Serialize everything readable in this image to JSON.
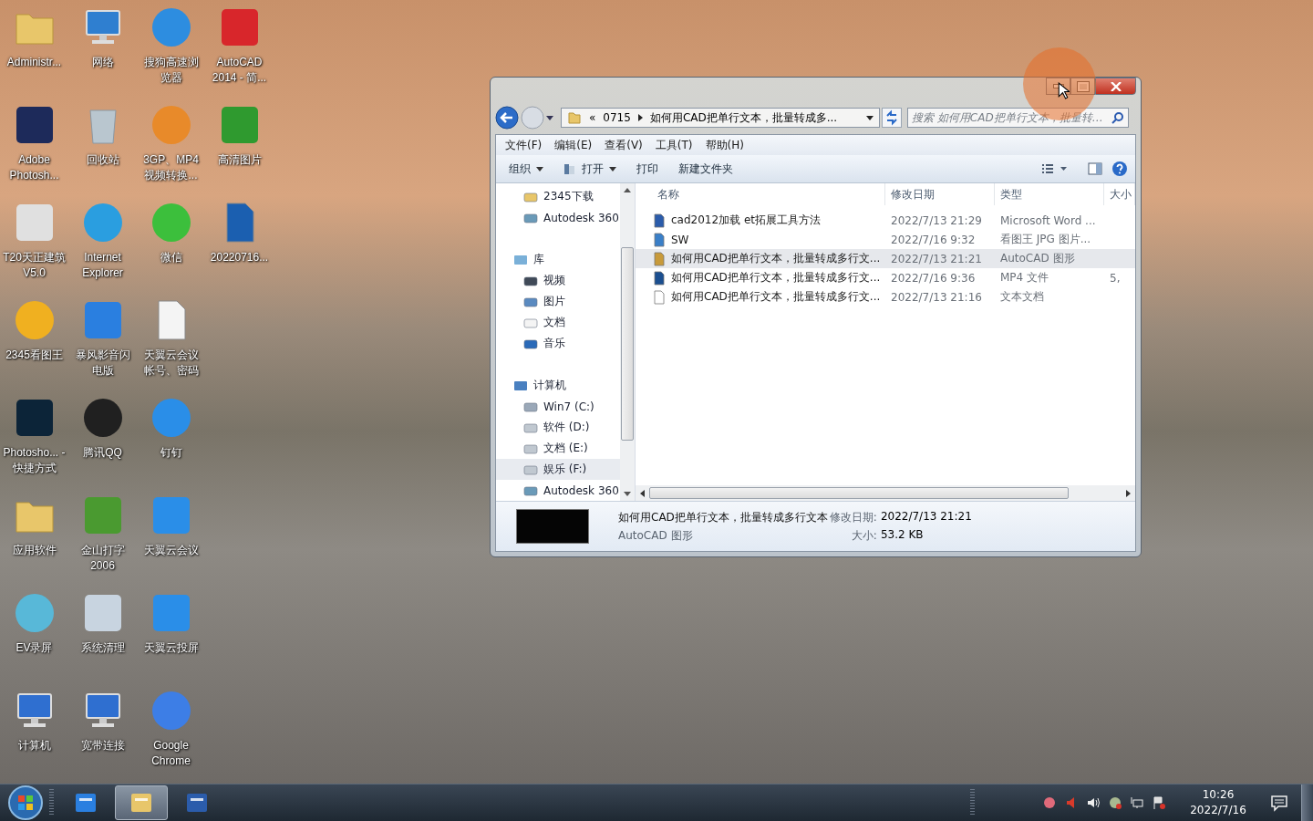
{
  "desktop_icons": [
    {
      "label": "Administr...",
      "kind": "folder",
      "color": "#e8c66a"
    },
    {
      "label": "Adobe Photosh...",
      "kind": "tile",
      "color": "#1d2a5a"
    },
    {
      "label": "T20天正建筑 V5.0",
      "kind": "tile",
      "color": "#e0e0e0"
    },
    {
      "label": "2345看图王",
      "kind": "circle",
      "color": "#f0b020"
    },
    {
      "label": "Photosho... - 快捷方式",
      "kind": "tile",
      "color": "#0c2438"
    },
    {
      "label": "应用软件",
      "kind": "folder",
      "color": "#e8c66a"
    },
    {
      "label": "EV录屏",
      "kind": "circle",
      "color": "#58b8d8"
    },
    {
      "label": "计算机",
      "kind": "monitor",
      "color": "#2f6fd0"
    },
    {
      "label": "网络",
      "kind": "monitor",
      "color": "#2f7fd0"
    },
    {
      "label": "回收站",
      "kind": "bin",
      "color": "#b9c6cf"
    },
    {
      "label": "Internet Explorer",
      "kind": "circle",
      "color": "#2a9ee0"
    },
    {
      "label": "暴风影音闪电版",
      "kind": "tile",
      "color": "#2a7fe0"
    },
    {
      "label": "腾讯QQ",
      "kind": "circle",
      "color": "#202020"
    },
    {
      "label": "金山打字 2006",
      "kind": "tile",
      "color": "#4a9a30"
    },
    {
      "label": "系统清理",
      "kind": "tile",
      "color": "#c8d4e0"
    },
    {
      "label": "宽带连接",
      "kind": "monitor",
      "color": "#2f6fd0"
    },
    {
      "label": "搜狗高速浏览器",
      "kind": "circle",
      "color": "#2d8de0"
    },
    {
      "label": "3GP、MP4视频转换...",
      "kind": "circle",
      "color": "#e88a2a"
    },
    {
      "label": "微信",
      "kind": "circle",
      "color": "#3cbf3c"
    },
    {
      "label": "天翼云会议帐号、密码",
      "kind": "doc",
      "color": "#f4f4f4"
    },
    {
      "label": "钉钉",
      "kind": "circle",
      "color": "#2a8ee8"
    },
    {
      "label": "天翼云会议",
      "kind": "tile",
      "color": "#2a8ee8"
    },
    {
      "label": "天翼云投屏",
      "kind": "tile",
      "color": "#2a8ee8"
    },
    {
      "label": "Google Chrome",
      "kind": "circle",
      "color": "#3d7ee6"
    },
    {
      "label": "AutoCAD 2014 - 简...",
      "kind": "tile",
      "color": "#d8262b"
    },
    {
      "label": "高清图片",
      "kind": "tile",
      "color": "#2f9a2f"
    },
    {
      "label": "20220716...",
      "kind": "doc",
      "color": "#1b5fb0"
    }
  ],
  "window": {
    "address": {
      "overflow": "«",
      "crumbs": [
        "0715",
        "如何用CAD把单行文本，批量转成多..."
      ]
    },
    "search": {
      "placeholder": "搜索 如何用CAD把单行文本，批量转…"
    },
    "menu": [
      "文件(F)",
      "编辑(E)",
      "查看(V)",
      "工具(T)",
      "帮助(H)"
    ],
    "toolbar": [
      {
        "label": "组织",
        "dropdown": true,
        "icon": false
      },
      {
        "label": "打开",
        "dropdown": true,
        "icon": true
      },
      {
        "label": "打印",
        "dropdown": false,
        "icon": false
      },
      {
        "label": "新建文件夹",
        "dropdown": false,
        "icon": false
      }
    ],
    "nav_tree": [
      {
        "children": [
          {
            "label": "2345下载",
            "kind": "folder",
            "selected": false
          },
          {
            "label": "Autodesk 360",
            "kind": "cloud",
            "selected": false
          }
        ]
      },
      {
        "label": "库",
        "kind": "library",
        "children": [
          {
            "label": "视频",
            "kind": "video",
            "selected": false
          },
          {
            "label": "图片",
            "kind": "picture",
            "selected": false
          },
          {
            "label": "文档",
            "kind": "document",
            "selected": false
          },
          {
            "label": "音乐",
            "kind": "music",
            "selected": false
          }
        ]
      },
      {
        "label": "计算机",
        "kind": "computer",
        "children": [
          {
            "label": "Win7 (C:)",
            "kind": "system-drive",
            "selected": false
          },
          {
            "label": "软件 (D:)",
            "kind": "drive",
            "selected": false
          },
          {
            "label": "文档 (E:)",
            "kind": "drive",
            "selected": false
          },
          {
            "label": "娱乐 (F:)",
            "kind": "drive",
            "selected": true
          },
          {
            "label": "Autodesk 360",
            "kind": "cloud",
            "selected": false
          }
        ]
      }
    ],
    "columns": [
      "名称",
      "修改日期",
      "类型",
      "大小"
    ],
    "files": [
      {
        "name": "cad2012加载 et拓展工具方法",
        "date": "2022/7/13 21:29",
        "type": "Microsoft Word ...",
        "kind": "word",
        "selected": false
      },
      {
        "name": "SW",
        "date": "2022/7/16 9:32",
        "type": "看图王 JPG 图片...",
        "kind": "jpg",
        "selected": false
      },
      {
        "name": "如何用CAD把单行文本，批量转成多行文...",
        "date": "2022/7/13 21:21",
        "type": "AutoCAD 图形",
        "kind": "dwg",
        "selected": true
      },
      {
        "name": "如何用CAD把单行文本，批量转成多行文...",
        "date": "2022/7/16 9:36",
        "type": "MP4 文件",
        "size": "5,",
        "kind": "video",
        "selected": false
      },
      {
        "name": "如何用CAD把单行文本，批量转成多行文...",
        "date": "2022/7/13 21:16",
        "type": "文本文档",
        "kind": "text",
        "selected": false
      }
    ],
    "details": {
      "name": "如何用CAD把单行文本，批量转成多行文本",
      "type": "AutoCAD 图形",
      "date_label": "修改日期:",
      "date": "2022/7/13 21:21",
      "size_label": "大小:",
      "size": "53.2 KB"
    }
  },
  "taskbar": {
    "apps": [
      {
        "kind": "video",
        "selected": false
      },
      {
        "kind": "explorer",
        "selected": true
      },
      {
        "kind": "word",
        "selected": false
      }
    ],
    "time": "10:26",
    "date": "2022/7/16"
  }
}
